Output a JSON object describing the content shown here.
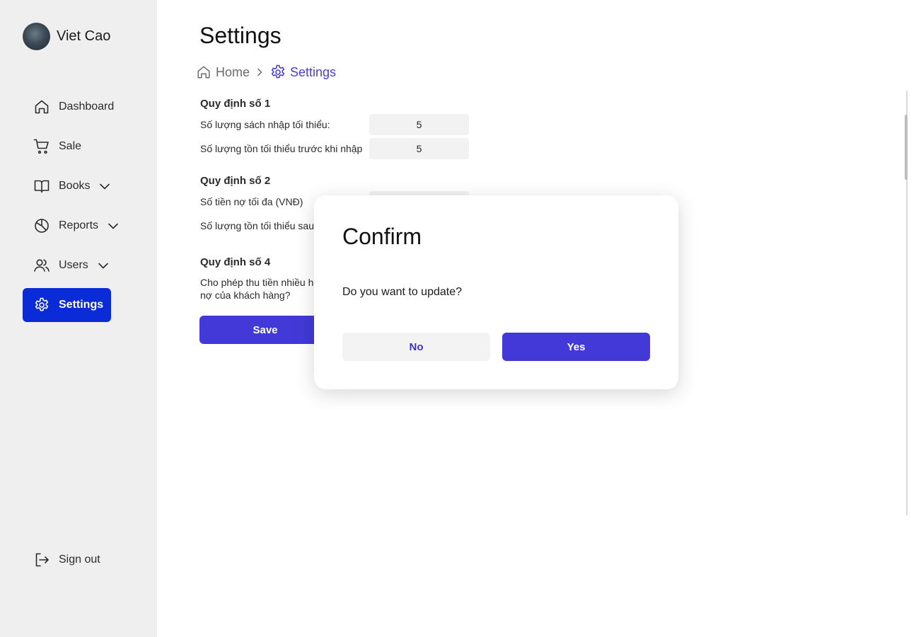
{
  "profile": {
    "name": "Viet Cao"
  },
  "sidebar": {
    "items": [
      {
        "label": "Dashboard",
        "icon": "home-icon"
      },
      {
        "label": "Sale",
        "icon": "cart-icon"
      },
      {
        "label": "Books",
        "icon": "book-icon",
        "expandable": true
      },
      {
        "label": "Reports",
        "icon": "pie-chart-icon",
        "expandable": true
      },
      {
        "label": "Users",
        "icon": "users-icon",
        "expandable": true
      },
      {
        "label": "Settings",
        "icon": "gear-icon",
        "active": true
      }
    ],
    "sign_out": "Sign out",
    "active_color": "#0a2bd8"
  },
  "page": {
    "title": "Settings"
  },
  "breadcrumb": {
    "home": "Home",
    "current": "Settings"
  },
  "rules": {
    "rule1": {
      "title": "Quy định số 1",
      "min_import_label": "Số lượng sách nhập tối thiểu:",
      "min_import_value": "5",
      "min_stock_before_label": "Số lượng tồn tối thiểu trước khi nhập",
      "min_stock_before_value": "5"
    },
    "rule2": {
      "title": "Quy định số 2",
      "max_debt_label": "Số tiền nợ tối đa (VNĐ)",
      "min_stock_after_label": "Số lượng tồn tối thiểu sau"
    },
    "rule4": {
      "title": "Quy định số 4",
      "overpay_label_line1": "Cho phép thu tiền nhiều h",
      "overpay_label_line2": "nợ của khách hàng?"
    }
  },
  "actions": {
    "save_label": "Save"
  },
  "dialog": {
    "title": "Confirm",
    "message": "Do you want to update?",
    "no_label": "No",
    "yes_label": "Yes"
  },
  "colors": {
    "primary": "#4339d8",
    "sidebar_bg": "#efefef"
  }
}
